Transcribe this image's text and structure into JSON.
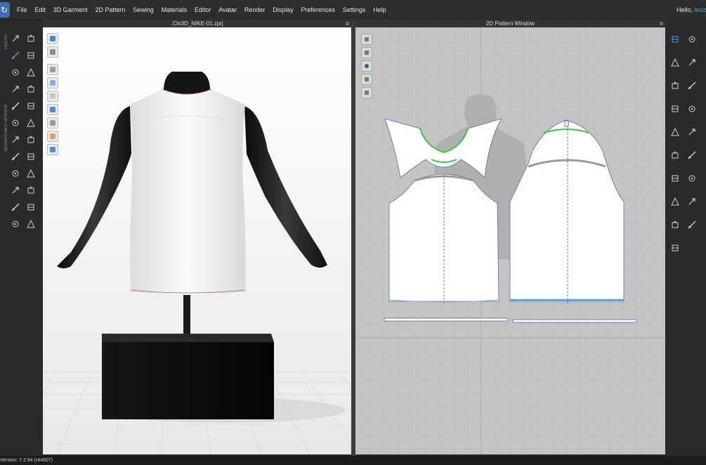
{
  "menubar": {
    "logo_glyph": "↻",
    "items": [
      "File",
      "Edit",
      "3D Garment",
      "2D Pattern",
      "Sewing",
      "Materials",
      "Editor",
      "Avatar",
      "Render",
      "Display",
      "Preferences",
      "Settings",
      "Help"
    ],
    "greeting": "Hello, ",
    "username": "leoz"
  },
  "left_toolbar": {
    "vertical_tabs": [
      "HISTORY",
      "MODULAR CONFIGURATOR"
    ],
    "icons": [
      "select-move-icon",
      "transform-pattern-icon",
      "edit-pattern-icon",
      "fold-arrangement-icon",
      "tack-icon",
      "pin-icon",
      "drag-icon",
      "fit-icon",
      "simulate-icon",
      "avatar-measure-icon",
      "3d-pen-icon",
      "topstitch-icon",
      "puckering-icon",
      "button-icon",
      "buttonhole-icon",
      "zipper-icon",
      "trim-icon",
      "graphic-icon",
      "texture-icon",
      "piping-icon",
      "elastic-icon",
      "line-icon",
      "shirring-icon",
      "bind-icon"
    ]
  },
  "view3d": {
    "title": ".Clo3D_NIKE-01.zprj",
    "overlay_tools": [
      "garment-icon",
      "shirt-icon",
      "texture-icon",
      "brush-icon",
      "avatar-icon",
      "transparent-icon",
      "show-avatar-icon",
      "skin-icon",
      "globe-icon"
    ]
  },
  "view2d": {
    "title": "2D Pattern Window",
    "side_tools": [
      "pen-icon",
      "select-icon",
      "info-icon",
      "copy-icon",
      "paste-icon"
    ]
  },
  "right_toolbar": {
    "icons": [
      "transform-pattern-2d-icon",
      "edit-curve-icon",
      "create-polygon-icon",
      "create-rectangle-icon",
      "create-circle-icon",
      "create-internal-icon",
      "trace-icon",
      "segment-sewing-icon",
      "free-sewing-icon",
      "check-sewing-icon",
      "seam-taping-icon",
      "notch-icon",
      "fold-icon",
      "text-icon",
      "annotation-icon",
      "grading-icon",
      "ruler-icon",
      "mannequin-icon",
      "zipper-2d-icon"
    ]
  },
  "colors": {
    "accent": "#3ea7e5",
    "sewing_line_green": "#37c837",
    "selection_blue": "#3aa0e8",
    "panel_bg": "#2a2a2a",
    "pattern_grid": "#c4c4c4"
  },
  "status": {
    "version": "Version: 7.2.94 (r44607)"
  }
}
